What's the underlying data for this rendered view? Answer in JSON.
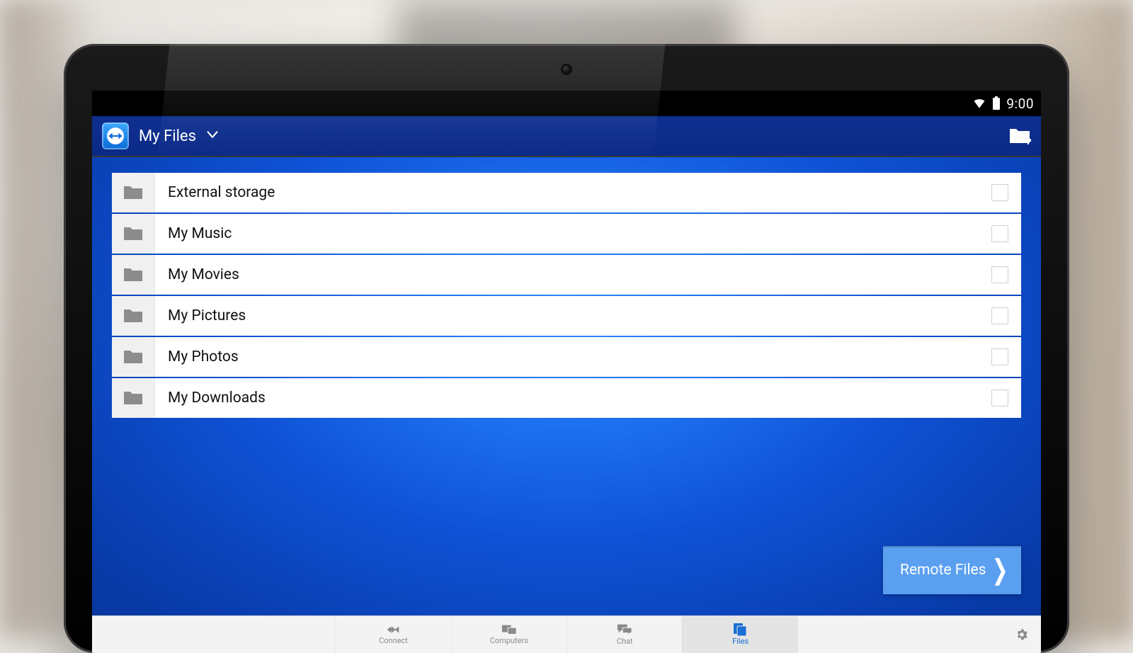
{
  "statusbar": {
    "time": "9:00"
  },
  "header": {
    "title": "My Files"
  },
  "folders": [
    {
      "label": "External storage"
    },
    {
      "label": "My Music"
    },
    {
      "label": "My Movies"
    },
    {
      "label": "My Pictures"
    },
    {
      "label": "My Photos"
    },
    {
      "label": "My Downloads"
    }
  ],
  "remote_button": {
    "label": "Remote Files"
  },
  "tabs": [
    {
      "label": "Connect",
      "icon": "connect",
      "active": false
    },
    {
      "label": "Computers",
      "icon": "computers",
      "active": false
    },
    {
      "label": "Chat",
      "icon": "chat",
      "active": false
    },
    {
      "label": "Files",
      "icon": "files",
      "active": true
    }
  ]
}
